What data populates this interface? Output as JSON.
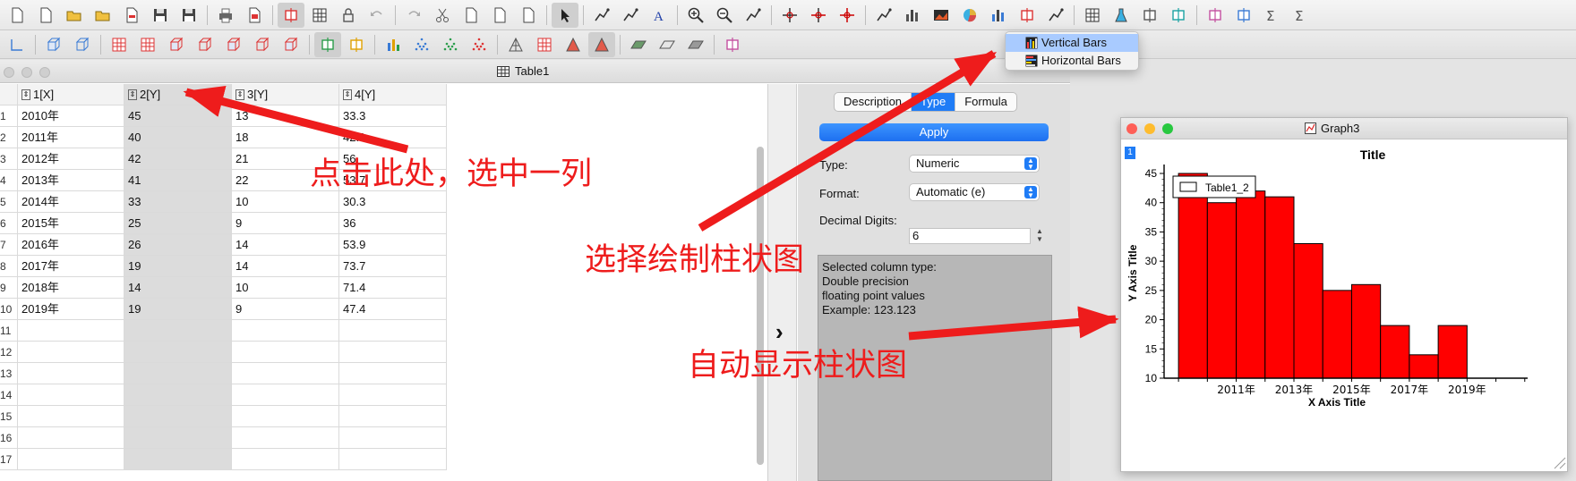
{
  "colors": {
    "accent": "#1f7cf6",
    "annotation": "#ee1c1c",
    "bar_fill": "#ff0000",
    "selected_column": "#dcdcdc"
  },
  "toolbar_top_icons": [
    "new-project-icon",
    "new-file-icon",
    "open-icon",
    "open-template-icon",
    "import-icon",
    "save-icon",
    "save-as-icon",
    "print-icon",
    "export-pdf-icon",
    "preview-icon",
    "table-icon",
    "lock-icon",
    "undo-icon",
    "redo-icon",
    "cut-icon",
    "copy-icon",
    "paste-icon",
    "clear-icon",
    "pointer-icon",
    "data-reader-icon",
    "screen-reader-icon",
    "text-icon",
    "zoom-in-icon",
    "zoom-out-icon",
    "rescale-icon",
    "crosshair-icon",
    "add-point-icon",
    "remove-point-icon",
    "line-plot-icon",
    "bar-chart-icon",
    "image-icon",
    "pie-chart-icon",
    "stacked-bar-icon",
    "box-plot-icon",
    "vector-icon",
    "matrix-icon",
    "flask-icon",
    "graph-icon",
    "swap-icon",
    "add-column-icon",
    "error-bar-icon",
    "sum-icon",
    "sigma-icon"
  ],
  "toolbar_3d_icons": [
    "axis-icon",
    "cube-icon",
    "cube-outline-icon",
    "grid-3d-icon",
    "mesh-icon",
    "cube-red-icon",
    "cube-red-outline-icon",
    "wire-icon",
    "wire-outline-icon",
    "frame-icon",
    "rotate-icon",
    "expand-icon",
    "bars-3d-icon",
    "scatter-3d-icon",
    "scatter-green-icon",
    "scatter-red-icon",
    "surface-icon",
    "mesh-surface-icon",
    "cone-icon",
    "cone-dark-icon",
    "plane-icon",
    "plane-outline-icon",
    "plane-gray-icon",
    "ribbon-icon"
  ],
  "table_window": {
    "title": "Table1",
    "row_numbers": [
      "1",
      "2",
      "3",
      "4",
      "5",
      "6",
      "7",
      "8",
      "9",
      "10",
      "11",
      "12",
      "13",
      "14",
      "15",
      "16",
      "17"
    ],
    "columns": [
      {
        "label": "1[X]"
      },
      {
        "label": "2[Y]"
      },
      {
        "label": "3[Y]"
      },
      {
        "label": "4[Y]"
      }
    ],
    "rows": [
      [
        "2010年",
        "45",
        "13",
        "33.3"
      ],
      [
        "2011年",
        "40",
        "18",
        "42.1"
      ],
      [
        "2012年",
        "42",
        "21",
        "56"
      ],
      [
        "2013年",
        "41",
        "22",
        "53.7"
      ],
      [
        "2014年",
        "33",
        "10",
        "30.3"
      ],
      [
        "2015年",
        "25",
        "9",
        "36"
      ],
      [
        "2016年",
        "26",
        "14",
        "53.9"
      ],
      [
        "2017年",
        "19",
        "14",
        "73.7"
      ],
      [
        "2018年",
        "14",
        "10",
        "71.4"
      ],
      [
        "2019年",
        "19",
        "9",
        "47.4"
      ]
    ]
  },
  "column_panel": {
    "tabs": [
      {
        "label": "Description"
      },
      {
        "label": "Type"
      },
      {
        "label": "Formula"
      }
    ],
    "apply_label": "Apply",
    "type_label": "Type:",
    "type_value": "Numeric",
    "format_label": "Format:",
    "format_value": "Automatic (e)",
    "digits_label": "Decimal Digits:",
    "digits_value": "6",
    "info_lines": [
      "Selected column type:",
      "Double precision",
      "floating point values",
      "Example: 123.123"
    ]
  },
  "bar_menu": {
    "items": [
      {
        "label": "Vertical Bars"
      },
      {
        "label": "Horizontal Bars"
      }
    ]
  },
  "graph_window": {
    "title": "Graph3",
    "layer": "1"
  },
  "chart_data": {
    "type": "bar",
    "title": "Title",
    "xlabel": "X Axis Title",
    "ylabel": "Y Axis Title",
    "categories": [
      "2010年",
      "2011年",
      "2012年",
      "2013年",
      "2014年",
      "2015年",
      "2016年",
      "2017年",
      "2018年",
      "2019年"
    ],
    "series": [
      {
        "name": "Table1_2",
        "values": [
          45,
          40,
          42,
          41,
          33,
          25,
          26,
          19,
          14,
          19
        ]
      }
    ],
    "ylim": [
      10,
      45
    ],
    "yticks": [
      10,
      15,
      20,
      25,
      30,
      35,
      40,
      45
    ],
    "xtick_labels": [
      "2011年",
      "2013年",
      "2015年",
      "2017年",
      "2019年"
    ],
    "legend": "top-left",
    "grid": false
  },
  "annotations": {
    "select_column": "点击此处，选中一列",
    "choose_bar": "选择绘制柱状图",
    "auto_show": "自动显示柱状图"
  }
}
